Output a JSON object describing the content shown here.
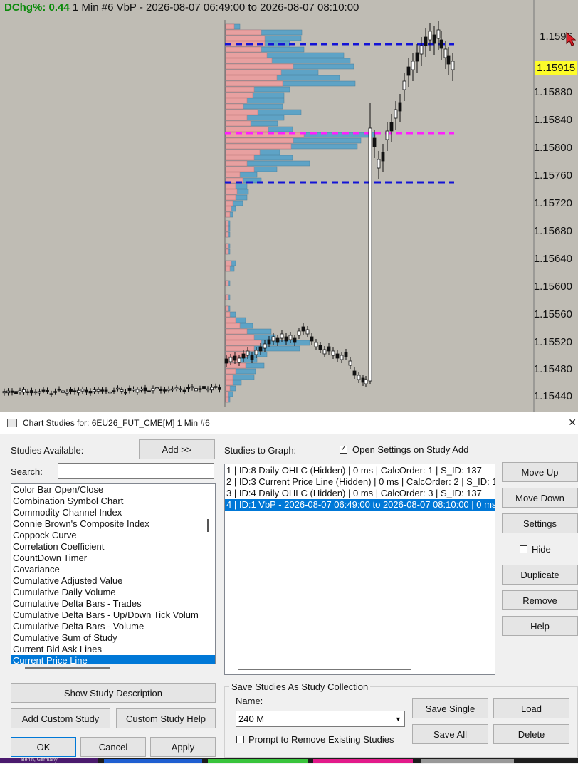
{
  "chart": {
    "header_dchg_label": "DChg%:",
    "header_dchg_value": "0.44",
    "header_rest": "1 Min  #6 VbP - 2026-08-07  06:49:00 to 2026-08-07  08:10:00",
    "price_labels": [
      "1.1596",
      "1.15880",
      "1.15840",
      "1.15800",
      "1.15760",
      "1.15720",
      "1.15680",
      "1.15640",
      "1.15600",
      "1.15560",
      "1.15520",
      "1.15480",
      "1.15440"
    ],
    "current_price": "1.15915",
    "colors": {
      "background": "#bfbcb4",
      "buy_volume": "#e8a0a0",
      "sell_volume": "#5ea3c6",
      "value_area_line": "#1313d6",
      "poc_line": "#ff1eff",
      "current_price_bg": "#fdfc2a"
    }
  },
  "dialog": {
    "title": "Chart Studies for: 6EU26_FUT_CME[M]  1 Min  #6",
    "close_icon": "close-icon",
    "studies_available_label": "Studies Available:",
    "add_button": "Add >>",
    "search_label": "Search:",
    "search_value": "",
    "available_studies": [
      "Color Bar Open/Close",
      "Combination Symbol Chart",
      "Commodity Channel Index",
      "Connie Brown's Composite Index",
      "Coppock Curve",
      "Correlation Coefficient",
      "CountDown Timer",
      "Covariance",
      "Cumulative Adjusted Value",
      "Cumulative Daily Volume",
      "Cumulative Delta Bars - Trades",
      "Cumulative Delta Bars - Up/Down Tick Volum",
      "Cumulative Delta Bars - Volume",
      "Cumulative Sum of Study",
      "Current Bid Ask Lines",
      "Current Price Line"
    ],
    "studies_to_graph_label": "Studies to Graph:",
    "open_settings_label": "Open Settings on Study Add",
    "studies_to_graph": [
      "1 | ID:8  Daily OHLC (Hidden) | 0 ms | CalcOrder: 1 | S_ID: 137",
      "2 | ID:3  Current Price Line (Hidden) | 0 ms | CalcOrder: 2 | S_ID: 1:",
      "3 | ID:4  Daily OHLC (Hidden) | 0 ms | CalcOrder: 3 | S_ID: 137",
      "4 | ID:1  VbP - 2026-08-07  06:49:00 to 2026-08-07  08:10:00 | 0 ms"
    ],
    "move_up": "Move Up",
    "move_down": "Move Down",
    "settings": "Settings",
    "hide": "Hide",
    "duplicate": "Duplicate",
    "remove": "Remove",
    "help": "Help",
    "show_study_description": "Show Study Description",
    "add_custom_study": "Add Custom Study",
    "custom_study_help": "Custom Study Help",
    "ok": "OK",
    "cancel": "Cancel",
    "apply": "Apply",
    "collection_group_label": "Save Studies As Study Collection",
    "name_label": "Name:",
    "name_value": "240 M",
    "prompt_label": "Prompt to Remove Existing Studies",
    "save_single": "Save Single",
    "load": "Load",
    "save_all": "Save All",
    "delete": "Delete"
  },
  "taskbar": {
    "item_label": "Berlin, Germany"
  }
}
